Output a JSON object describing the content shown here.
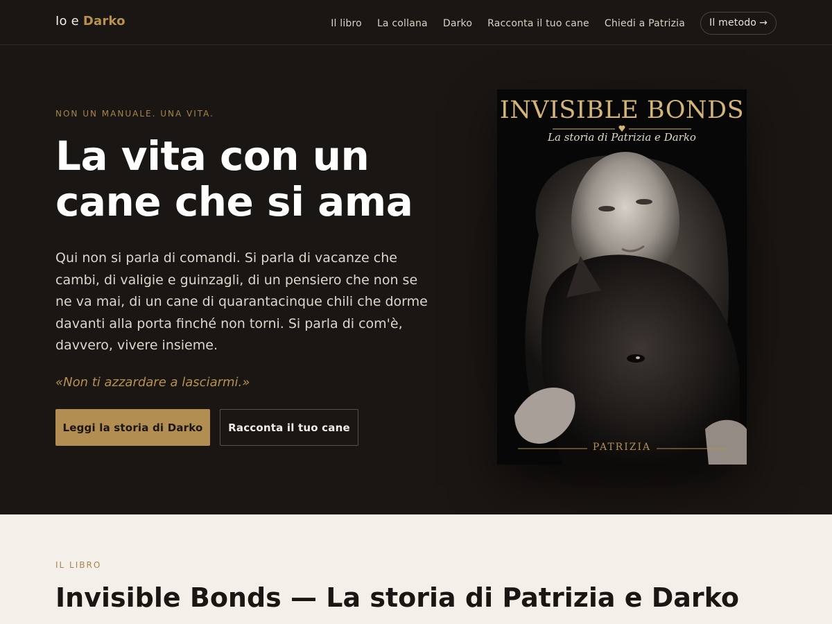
{
  "header": {
    "brand_prefix": "Io e ",
    "brand_accent": "Darko",
    "nav": [
      "Il libro",
      "La collana",
      "Darko",
      "Racconta il tuo cane",
      "Chiedi a Patrizia"
    ],
    "cta_label": "Il metodo",
    "cta_arrow": "→"
  },
  "hero": {
    "eyebrow": "NON UN MANUALE. UNA VITA.",
    "title_line1": "La vita con un",
    "title_line2": "cane che si ama",
    "text": "Qui non si parla di comandi. Si parla di vacanze che cambi, di valigie e guinzagli, di un pensiero che non se ne va mai, di un cane di quarantacinque chili che dorme davanti alla porta finché non torni. Si parla di com'è, davvero, vivere insieme.",
    "quote": "«Non ti azzardare a lasciarmi.»",
    "primary_button": "Leggi la storia di Darko",
    "secondary_button": "Racconta il tuo cane"
  },
  "book_cover": {
    "title": "INVISIBLE BONDS",
    "subtitle": "La storia di Patrizia e Darko",
    "author": "PATRIZIA"
  },
  "book_section": {
    "eyebrow": "IL LIBRO",
    "title": "Invisible Bonds — La storia di Patrizia e Darko"
  },
  "colors": {
    "background_dark": "#1a1613",
    "accent_gold": "#b38e52",
    "background_light": "#f4efe8"
  }
}
